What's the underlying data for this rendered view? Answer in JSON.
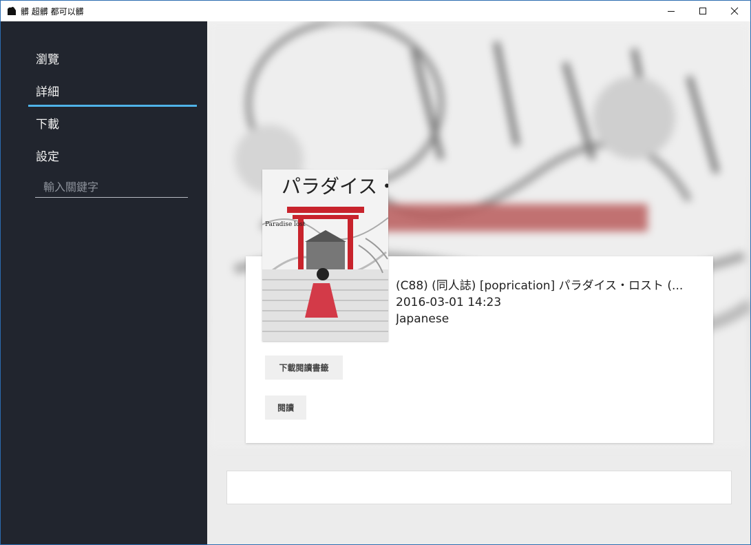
{
  "window": {
    "title": "髒 超髒 都可以髒"
  },
  "sidebar": {
    "items": [
      {
        "label": "瀏覽"
      },
      {
        "label": "詳細"
      },
      {
        "label": "下載"
      },
      {
        "label": "設定"
      }
    ],
    "active_index": 1,
    "search": {
      "placeholder": "輸入關鍵字",
      "value": ""
    }
  },
  "detail": {
    "title": "(C88) (同人誌) [poprication] パラダイス・ロスト (...",
    "date": "2016-03-01 14:23",
    "language": "Japanese",
    "cover_text": {
      "title": "パラダイス・ロスト",
      "subtitle": "Paradise lost"
    },
    "buttons": {
      "download_label": "下載閱讀書籤",
      "read_label": "閱讀"
    }
  },
  "colors": {
    "sidebar_bg": "#21252e",
    "accent": "#4fb3e8",
    "main_bg": "#ececec"
  }
}
